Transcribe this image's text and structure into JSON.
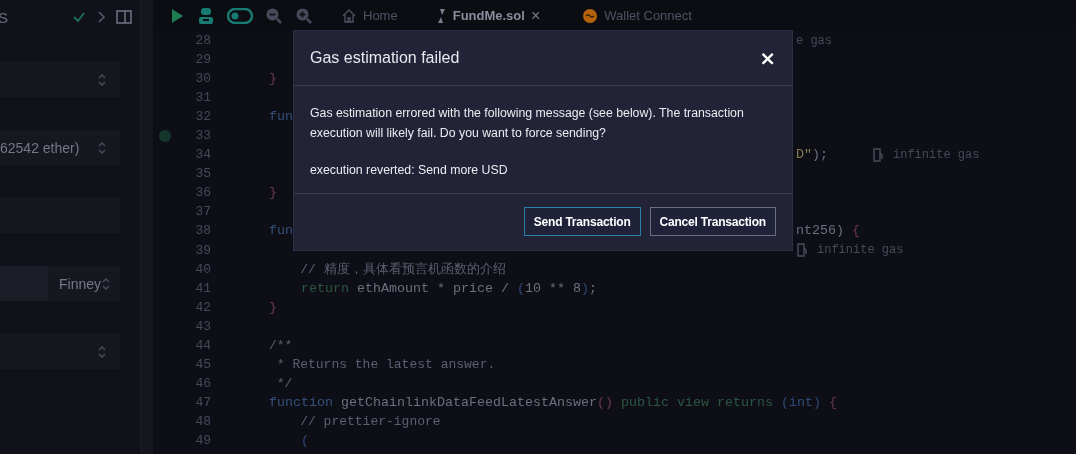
{
  "sidebar": {
    "title": "S",
    "fields": [
      {
        "kind": "select"
      },
      {
        "kind": "select",
        "value": "62542 ether)"
      },
      {
        "kind": "input"
      },
      {
        "kind": "amount",
        "unit": "Finney"
      },
      {
        "kind": "select"
      }
    ]
  },
  "toolbar": {
    "toggle_on": true
  },
  "tabs": [
    {
      "kind": "home",
      "label": "Home",
      "selected": false
    },
    {
      "kind": "file",
      "label": "FundMe.sol",
      "selected": true,
      "close": "×"
    },
    {
      "kind": "plugin",
      "label": "Wallet Connect",
      "selected": false
    }
  ],
  "editor": {
    "lines": [
      {
        "number": "28",
        "marked": false,
        "tail": [
          {
            "kind": "hint",
            "text": "e gas"
          }
        ]
      },
      {
        "number": "29",
        "marked": false
      },
      {
        "number": "30",
        "marked": false,
        "parts": [
          {
            "kind": "bracket",
            "text": "}"
          }
        ]
      },
      {
        "number": "31",
        "marked": false
      },
      {
        "number": "32",
        "marked": false,
        "parts": [
          {
            "kind": "keyword",
            "text": "fun"
          }
        ]
      },
      {
        "number": "33",
        "marked": true
      },
      {
        "number": "34",
        "marked": false,
        "tail": [
          {
            "kind": "string",
            "text": "D\""
          },
          {
            "kind": "plain",
            "text": ");"
          },
          {
            "kind": "gas",
            "text": "infinite gas"
          }
        ]
      },
      {
        "number": "35",
        "marked": false
      },
      {
        "number": "36",
        "marked": false,
        "parts": [
          {
            "kind": "bracket",
            "text": "}"
          }
        ]
      },
      {
        "number": "37",
        "marked": false
      },
      {
        "number": "38",
        "marked": false,
        "parts": [
          {
            "kind": "keyword",
            "text": "fun"
          }
        ],
        "tail": [
          {
            "kind": "plain",
            "text": "nt256) "
          },
          {
            "kind": "bracket",
            "text": "{"
          }
        ]
      },
      {
        "number": "39",
        "marked": false,
        "tail": [
          {
            "kind": "gas",
            "text": "infinite gas"
          }
        ]
      },
      {
        "number": "40",
        "marked": false,
        "parts": [
          {
            "kind": "comment",
            "text": "    // 精度，具体看预言机函数的介绍"
          }
        ]
      },
      {
        "number": "41",
        "marked": false,
        "parts": [
          {
            "kind": "control",
            "text": "    return"
          },
          {
            "kind": "plain",
            "text": " ethAmount * price / "
          },
          {
            "kind": "paren",
            "text": "("
          },
          {
            "kind": "plain",
            "text": "10 ** 8"
          },
          {
            "kind": "paren",
            "text": ")"
          },
          {
            "kind": "plain",
            "text": ";"
          }
        ]
      },
      {
        "number": "42",
        "marked": false,
        "parts": [
          {
            "kind": "bracket",
            "text": "}"
          }
        ]
      },
      {
        "number": "43",
        "marked": false
      },
      {
        "number": "44",
        "marked": false,
        "parts": [
          {
            "kind": "comment",
            "text": "/**"
          }
        ]
      },
      {
        "number": "45",
        "marked": false,
        "parts": [
          {
            "kind": "comment",
            "text": " * Returns the latest answer."
          }
        ]
      },
      {
        "number": "46",
        "marked": false,
        "parts": [
          {
            "kind": "comment",
            "text": " */"
          }
        ]
      },
      {
        "number": "47",
        "marked": false,
        "parts": [
          {
            "kind": "keyword",
            "text": "function"
          },
          {
            "kind": "plain",
            "text": " getChainlinkDataFeedLatestAnswer"
          },
          {
            "kind": "bracket",
            "text": "()"
          },
          {
            "kind": "control",
            "text": " public view returns"
          },
          {
            "kind": "paren",
            "text": " (int)"
          },
          {
            "kind": "bracket",
            "text": " {"
          }
        ]
      },
      {
        "number": "48",
        "marked": false,
        "parts": [
          {
            "kind": "comment",
            "text": "    // prettier-ignore"
          }
        ]
      },
      {
        "number": "49",
        "marked": false,
        "parts": [
          {
            "kind": "paren",
            "text": "    ("
          }
        ]
      }
    ]
  },
  "dialog": {
    "title": "Gas estimation failed",
    "close": "×",
    "message": "Gas estimation errored with the following message (see below). The transaction execution will likely fail. Do you want to force sending?",
    "detail": "execution reverted: Send more USD",
    "buttons": [
      {
        "label": "Send Transaction",
        "focused": true
      },
      {
        "label": "Cancel Transaction",
        "focused": false
      }
    ]
  }
}
